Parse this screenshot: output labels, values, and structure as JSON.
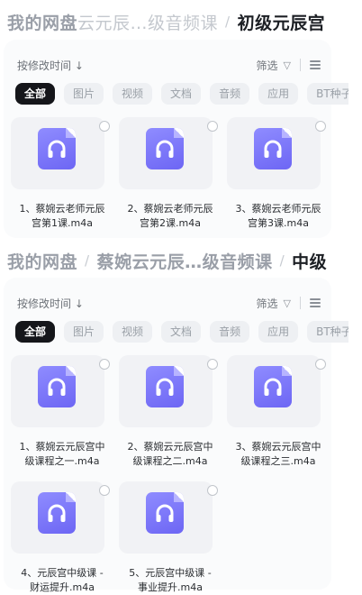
{
  "sections": [
    {
      "breadcrumb": {
        "root": "我的网盘",
        "mid_faded": "云元辰…级音频课",
        "current": "初级元辰宫"
      },
      "sort_label": "按修改时间 ↓",
      "filter_label": "筛选",
      "tabs": [
        "全部",
        "图片",
        "视频",
        "文档",
        "音频",
        "应用",
        "BT种子"
      ],
      "files": [
        {
          "line1": "1、蔡婉云老师元辰",
          "line2": "宫第1课.m4a"
        },
        {
          "line1": "2、蔡婉云老师元辰",
          "line2": "宫第2课.m4a"
        },
        {
          "line1": "3、蔡婉云老师元辰",
          "line2": "宫第3课.m4a"
        }
      ]
    },
    {
      "breadcrumb": {
        "root": "我的网盘",
        "mid_faded": "蔡婉云元辰…级音频课",
        "current": "中级"
      },
      "sort_label": "按修改时间 ↓",
      "filter_label": "筛选",
      "tabs": [
        "全部",
        "图片",
        "视频",
        "文档",
        "音频",
        "应用",
        "BT种子"
      ],
      "files": [
        {
          "line1": "1、蔡婉云元辰宫中",
          "line2": "级课程之一.m4a"
        },
        {
          "line1": "2、蔡婉云元辰宫中",
          "line2": "级课程之二.m4a"
        },
        {
          "line1": "3、蔡婉云元辰宫中",
          "line2": "级课程之三.m4a"
        },
        {
          "line1": "4、元辰宫中级课 -",
          "line2": "财运提升.m4a"
        },
        {
          "line1": "5、元辰宫中级课 -",
          "line2": "事业提升.m4a"
        }
      ]
    }
  ],
  "colors": {
    "file_icon": "#7a75ff",
    "active_tab": "#15161a"
  },
  "icons": {
    "file_type": "headphones-icon",
    "filter": "funnel-icon",
    "view": "list-view-icon",
    "select": "radio-circle-icon"
  }
}
